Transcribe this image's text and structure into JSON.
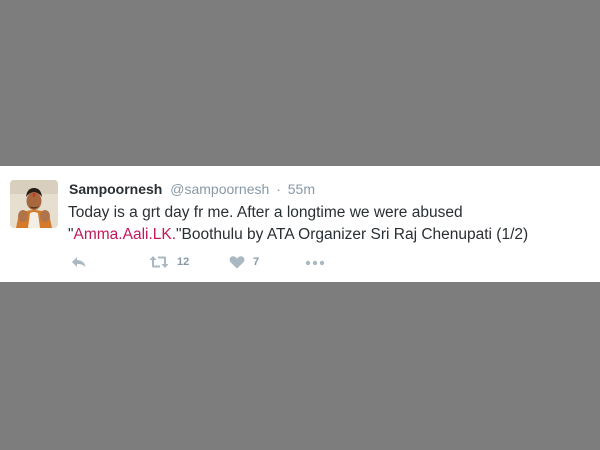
{
  "tweet": {
    "display_name": "Sampoornesh",
    "handle": "@sampoornesh",
    "separator": "·",
    "time": "55m",
    "text_line1": "Today is a grt day fr me. After a longtime we were  abused",
    "text_line2_quote_open": "\"",
    "text_line2_link": "Amma.Aali.LK.",
    "text_line2_rest": "\"Boothulu by ATA Organizer Sri Raj Chenupati (1/2)"
  },
  "actions": {
    "retweet_count": "12",
    "like_count": "7"
  },
  "icons": {
    "reply": "reply-icon",
    "retweet": "retweet-icon",
    "like": "heart-icon",
    "more": "more-icon"
  },
  "colors": {
    "background": "#7d7d7d",
    "card": "#ffffff",
    "link": "#c2185b",
    "icon": "#aab8c2"
  }
}
